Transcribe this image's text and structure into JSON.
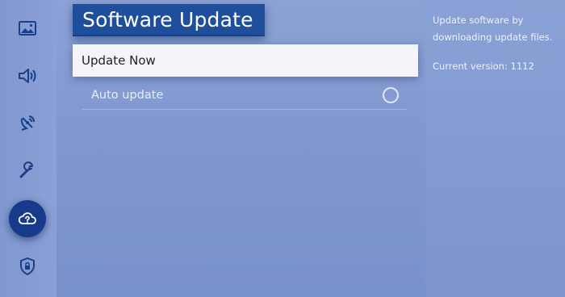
{
  "sidebar": {
    "items": [
      {
        "icon": "picture-icon",
        "label": ""
      },
      {
        "icon": "sound-icon",
        "label": ""
      },
      {
        "icon": "broadcast-icon",
        "label": ""
      },
      {
        "icon": "wrench-icon",
        "label": ""
      },
      {
        "icon": "cloud-support-icon",
        "label": "",
        "active": true
      },
      {
        "icon": "shield-icon",
        "label": ""
      }
    ]
  },
  "main": {
    "title": "Software Update",
    "items": [
      {
        "label": "Update Now",
        "selected": true
      },
      {
        "label": "Auto update",
        "toggle": false
      }
    ]
  },
  "info": {
    "description": "Update software by downloading update files.",
    "version": "Current version: 1112"
  },
  "colors": {
    "background": "#8ba2d6",
    "title_background": "#1e4e9c",
    "active_icon_background": "#173b8a",
    "selected_item_background": "#f4f5f8"
  }
}
